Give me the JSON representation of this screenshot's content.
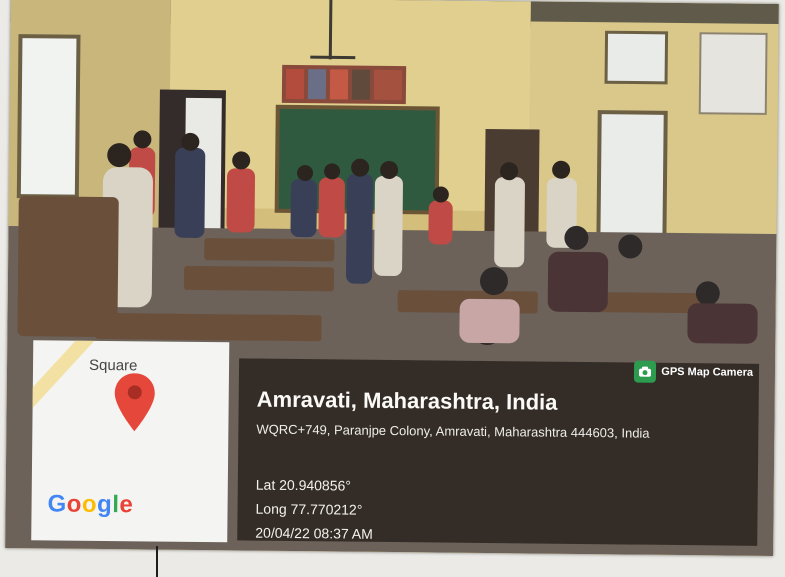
{
  "map": {
    "label": "Square",
    "pin_icon": "map-pin-icon",
    "brand_letters": [
      "G",
      "o",
      "o",
      "g",
      "l",
      "e"
    ],
    "brand_colors": [
      "#4285f4",
      "#ea4335",
      "#fbbc05",
      "#4285f4",
      "#34a853",
      "#ea4335"
    ]
  },
  "app": {
    "name": "GPS Map Camera",
    "icon": "camera-icon",
    "accent": "#2e9c4f"
  },
  "location": {
    "title": "Amravati, Maharashtra, India",
    "address": "WQRC+749, Paranjpe Colony, Amravati, Maharashtra 444603, India",
    "lat": "Lat 20.940856°",
    "long": "Long 77.770212°",
    "timestamp": "20/04/22 08:37 AM"
  },
  "colors": {
    "wall": "#d7c37f",
    "blackboard": "#2f5a40",
    "overlay": "#1e1914"
  }
}
